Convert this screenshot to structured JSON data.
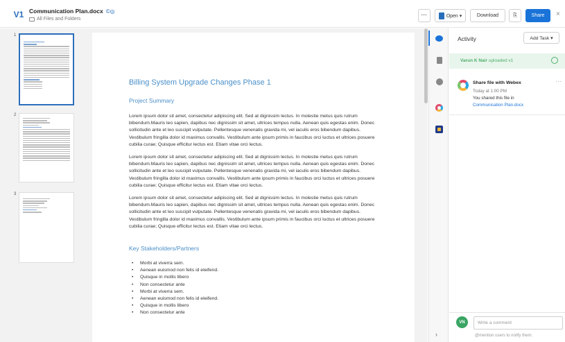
{
  "header": {
    "version": "V1",
    "file_name": "Communication Plan.docx",
    "file_icons": "©◎",
    "path": "All Files and Folders",
    "more_label": "···",
    "open_label": "Open ▾",
    "download_label": "Download",
    "link_icon": "⎘",
    "share_label": "Share",
    "close_label": "×"
  },
  "thumbnails": {
    "pages": [
      "1",
      "2",
      "3"
    ]
  },
  "document": {
    "title": "Billing System Upgrade Changes Phase 1",
    "section1": "Project Summary",
    "paragraphs": [
      "Lorem ipsum dolor sit amet, consectetur adipiscing elit. Sed at dignissim lectus. In molestie metus quis rutrum bibendum.Mauris leo sapien, dapibus nec dignissim sit amet, ultrices tempus nulla. Aenean quis egestas enim. Donec sollicitudin ante et leo suscipit vulputate. Pellentesque venenatis gravida mi, vel iaculis eros bibendum dapibus. Vestibulum fringilla dolor id maximus convallis. Vestibulum ante ipsum primis in faucibus orci luctus et ultrices posuere cubilia curae; Quisque efficitur lectus est. Etiam vitae orci lectus.",
      "Lorem ipsum dolor sit amet, consectetur adipiscing elit. Sed at dignissim lectus. In molestie metus quis rutrum bibendum.Mauris leo sapien, dapibus nec dignissim sit amet, ultrices tempus nulla. Aenean quis egestas enim. Donec sollicitudin ante et leo suscipit vulputate. Pellentesque venenatis gravida mi, vel iaculis eros bibendum dapibus. Vestibulum fringilla dolor id maximus convallis. Vestibulum ante ipsum primis in faucibus orci luctus et ultrices posuere cubilia curae; Quisque efficitur lectus est. Etiam vitae orci lectus.",
      "Lorem ipsum dolor sit amet, consectetur adipiscing elit. Sed at dignissim lectus. In molestie metus quis rutrum bibendum.Mauris leo sapien, dapibus nec dignissim sit amet, ultrices tempus nulla. Aenean quis egestas enim. Donec sollicitudin ante et leo suscipit vulputate. Pellentesque venenatis gravida mi, vel iaculis eros bibendum dapibus. Vestibulum fringilla dolor id maximus convallis. Vestibulum ante ipsum primis in faucibus orci luctus et ultrices posuere cubilia curae; Quisque efficitur lectus est. Etiam vitae orci lectus."
    ],
    "section2": "Key Stakeholders/Partners",
    "bullets": [
      "Morbi at viverra sem.",
      "Aenean euismod non felis id eleifend.",
      "Quisque in mollis libero",
      "Non consectetur ante",
      "Morbi at viverra sem.",
      "Aenean euismod non felis id eleifend.",
      "Quisque in mollis libero",
      "Non consectetur ante"
    ]
  },
  "rail": {
    "items": [
      "chat-icon",
      "document-icon",
      "message-icon",
      "webex-icon",
      "app-icon"
    ],
    "collapse_label": "›"
  },
  "activity": {
    "title": "Activity",
    "add_task_label": "Add Task ▾",
    "upload_user": "Varun K Nair",
    "upload_action": "uploaded v1",
    "feed": {
      "title": "Share file with Webex",
      "more": "···",
      "time": "Today at 1:00 PM",
      "desc": "You shared this file in",
      "link": "Communication Plan.docx"
    },
    "avatar_initials": "VN",
    "comment_placeholder": "Write a comment",
    "hint": "@mention users to notify them."
  },
  "colors": {
    "accent": "#1a73d8",
    "heading": "#4a8fc9",
    "success": "#4caf6a"
  }
}
